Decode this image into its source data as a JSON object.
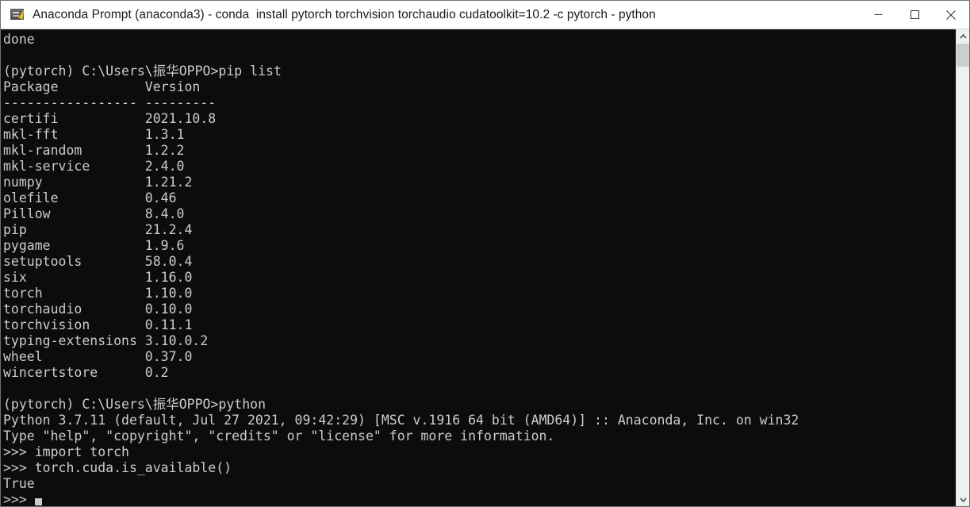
{
  "window": {
    "title": "Anaconda Prompt (anaconda3) - conda  install pytorch torchvision torchaudio cudatoolkit=10.2 -c pytorch - python",
    "icon": "console-icon",
    "background_color": "#0c0c0c",
    "text_color": "#cccccc",
    "titlebar_color": "#ffffff"
  },
  "controls": {
    "minimize_label": "Minimize",
    "maximize_label": "Maximize",
    "close_label": "Close"
  },
  "scrollbar": {
    "up_arrow": "chevron-up-icon",
    "down_arrow": "chevron-down-icon",
    "thumb_position": "top"
  },
  "terminal": {
    "prompt_env": "(pytorch)",
    "prompt_path": "C:\\Users\\振华OPPO>",
    "commands": [
      "pip list",
      "python",
      "import torch",
      "torch.cuda.is_available()"
    ],
    "pip_list": {
      "headers": [
        "Package",
        "Version"
      ],
      "separator": "----------------- ---------",
      "rows": [
        [
          "certifi",
          "2021.10.8"
        ],
        [
          "mkl-fft",
          "1.3.1"
        ],
        [
          "mkl-random",
          "1.2.2"
        ],
        [
          "mkl-service",
          "2.4.0"
        ],
        [
          "numpy",
          "1.21.2"
        ],
        [
          "olefile",
          "0.46"
        ],
        [
          "Pillow",
          "8.4.0"
        ],
        [
          "pip",
          "21.2.4"
        ],
        [
          "pygame",
          "1.9.6"
        ],
        [
          "setuptools",
          "58.0.4"
        ],
        [
          "six",
          "1.16.0"
        ],
        [
          "torch",
          "1.10.0"
        ],
        [
          "torchaudio",
          "0.10.0"
        ],
        [
          "torchvision",
          "0.11.1"
        ],
        [
          "typing-extensions",
          "3.10.0.2"
        ],
        [
          "wheel",
          "0.37.0"
        ],
        [
          "wincertstore",
          "0.2"
        ]
      ]
    },
    "python_banner": [
      "Python 3.7.11 (default, Jul 27 2021, 09:42:29) [MSC v.1916 64 bit (AMD64)] :: Anaconda, Inc. on win32",
      "Type \"help\", \"copyright\", \"credits\" or \"license\" for more information."
    ],
    "python_prompt": ">>>",
    "result": "True",
    "first_line": "done",
    "full_text": "done\n\n(pytorch) C:\\Users\\振华OPPO>pip list\nPackage           Version\n----------------- ---------\ncertifi           2021.10.8\nmkl-fft           1.3.1\nmkl-random        1.2.2\nmkl-service       2.4.0\nnumpy             1.21.2\nolefile           0.46\nPillow            8.4.0\npip               21.2.4\npygame            1.9.6\nsetuptools        58.0.4\nsix               1.16.0\ntorch             1.10.0\ntorchaudio        0.10.0\ntorchvision       0.11.1\ntyping-extensions 3.10.0.2\nwheel             0.37.0\nwincertstore      0.2\n\n(pytorch) C:\\Users\\振华OPPO>python\nPython 3.7.11 (default, Jul 27 2021, 09:42:29) [MSC v.1916 64 bit (AMD64)] :: Anaconda, Inc. on win32\nType \"help\", \"copyright\", \"credits\" or \"license\" for more information.\n>>> import torch\n>>> torch.cuda.is_available()\nTrue\n>>> "
  }
}
